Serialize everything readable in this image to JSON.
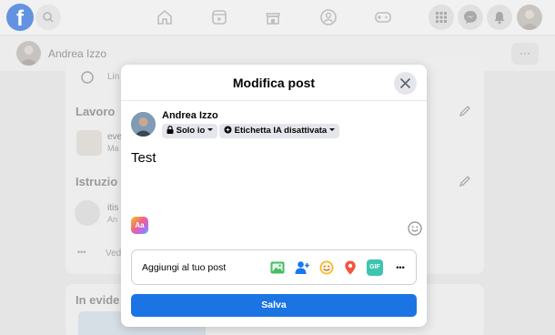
{
  "background": {
    "profile_name": "Andrea Izzo",
    "more_label": "···",
    "fb_logo_letter": "f",
    "sidebar": {
      "row1_text": "Lin",
      "work_heading": "Lavoro",
      "work_item_line1": "eve",
      "work_item_line2": "Ma",
      "education_heading": "Istruzio",
      "education_item_line1": "itis",
      "education_item_line2": "An",
      "see_more_dots": "•••",
      "see_more_text": "Ved",
      "featured_heading": "In evide"
    }
  },
  "modal": {
    "title": "Modifica post",
    "author_name": "Andrea Izzo",
    "privacy_label": "Solo io",
    "ai_label": "Etichetta IA disattivata",
    "post_text": "Test",
    "aa_label": "Aa",
    "add_to_post_label": "Aggiungi al tuo post",
    "gif_label": "GIF",
    "more_dots": "•••",
    "save_label": "Salva"
  },
  "colors": {
    "primary": "#1b74e4",
    "fb_blue": "#2f6fd6",
    "photo_green": "#45bd62",
    "tag_blue": "#1877f2",
    "feeling_orange": "#f7b928",
    "location_red": "#f5533d",
    "gif_teal": "#3dc5b0"
  },
  "icons": [
    "home-icon",
    "video-icon",
    "marketplace-icon",
    "groups-icon",
    "gaming-icon",
    "menu-grid-icon",
    "messenger-icon",
    "bell-icon",
    "lock-icon",
    "ai-tag-icon",
    "close-icon",
    "emoji-icon",
    "photo-icon",
    "tag-people-icon",
    "feeling-icon",
    "location-icon",
    "gif-icon",
    "more-icon",
    "pencil-icon"
  ]
}
